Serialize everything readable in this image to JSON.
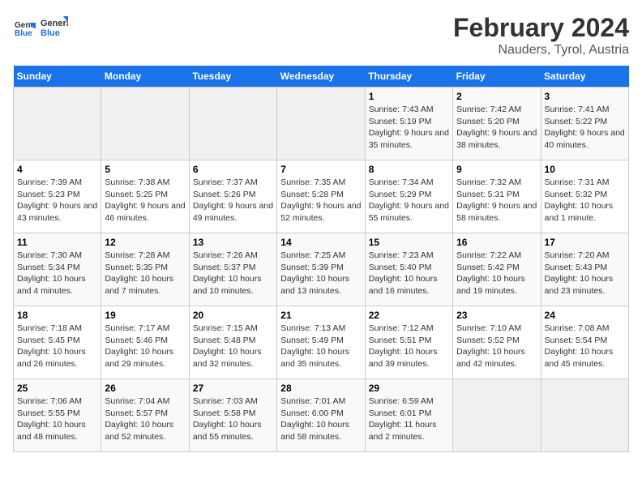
{
  "header": {
    "logo_text_general": "General",
    "logo_text_blue": "Blue",
    "title": "February 2024",
    "subtitle": "Nauders, Tyrol, Austria"
  },
  "calendar": {
    "days_of_week": [
      "Sunday",
      "Monday",
      "Tuesday",
      "Wednesday",
      "Thursday",
      "Friday",
      "Saturday"
    ],
    "weeks": [
      [
        {
          "day": "",
          "info": ""
        },
        {
          "day": "",
          "info": ""
        },
        {
          "day": "",
          "info": ""
        },
        {
          "day": "",
          "info": ""
        },
        {
          "day": "1",
          "info": "Sunrise: 7:43 AM\nSunset: 5:19 PM\nDaylight: 9 hours and 35 minutes."
        },
        {
          "day": "2",
          "info": "Sunrise: 7:42 AM\nSunset: 5:20 PM\nDaylight: 9 hours and 38 minutes."
        },
        {
          "day": "3",
          "info": "Sunrise: 7:41 AM\nSunset: 5:22 PM\nDaylight: 9 hours and 40 minutes."
        }
      ],
      [
        {
          "day": "4",
          "info": "Sunrise: 7:39 AM\nSunset: 5:23 PM\nDaylight: 9 hours and 43 minutes."
        },
        {
          "day": "5",
          "info": "Sunrise: 7:38 AM\nSunset: 5:25 PM\nDaylight: 9 hours and 46 minutes."
        },
        {
          "day": "6",
          "info": "Sunrise: 7:37 AM\nSunset: 5:26 PM\nDaylight: 9 hours and 49 minutes."
        },
        {
          "day": "7",
          "info": "Sunrise: 7:35 AM\nSunset: 5:28 PM\nDaylight: 9 hours and 52 minutes."
        },
        {
          "day": "8",
          "info": "Sunrise: 7:34 AM\nSunset: 5:29 PM\nDaylight: 9 hours and 55 minutes."
        },
        {
          "day": "9",
          "info": "Sunrise: 7:32 AM\nSunset: 5:31 PM\nDaylight: 9 hours and 58 minutes."
        },
        {
          "day": "10",
          "info": "Sunrise: 7:31 AM\nSunset: 5:32 PM\nDaylight: 10 hours and 1 minute."
        }
      ],
      [
        {
          "day": "11",
          "info": "Sunrise: 7:30 AM\nSunset: 5:34 PM\nDaylight: 10 hours and 4 minutes."
        },
        {
          "day": "12",
          "info": "Sunrise: 7:28 AM\nSunset: 5:35 PM\nDaylight: 10 hours and 7 minutes."
        },
        {
          "day": "13",
          "info": "Sunrise: 7:26 AM\nSunset: 5:37 PM\nDaylight: 10 hours and 10 minutes."
        },
        {
          "day": "14",
          "info": "Sunrise: 7:25 AM\nSunset: 5:39 PM\nDaylight: 10 hours and 13 minutes."
        },
        {
          "day": "15",
          "info": "Sunrise: 7:23 AM\nSunset: 5:40 PM\nDaylight: 10 hours and 16 minutes."
        },
        {
          "day": "16",
          "info": "Sunrise: 7:22 AM\nSunset: 5:42 PM\nDaylight: 10 hours and 19 minutes."
        },
        {
          "day": "17",
          "info": "Sunrise: 7:20 AM\nSunset: 5:43 PM\nDaylight: 10 hours and 23 minutes."
        }
      ],
      [
        {
          "day": "18",
          "info": "Sunrise: 7:18 AM\nSunset: 5:45 PM\nDaylight: 10 hours and 26 minutes."
        },
        {
          "day": "19",
          "info": "Sunrise: 7:17 AM\nSunset: 5:46 PM\nDaylight: 10 hours and 29 minutes."
        },
        {
          "day": "20",
          "info": "Sunrise: 7:15 AM\nSunset: 5:48 PM\nDaylight: 10 hours and 32 minutes."
        },
        {
          "day": "21",
          "info": "Sunrise: 7:13 AM\nSunset: 5:49 PM\nDaylight: 10 hours and 35 minutes."
        },
        {
          "day": "22",
          "info": "Sunrise: 7:12 AM\nSunset: 5:51 PM\nDaylight: 10 hours and 39 minutes."
        },
        {
          "day": "23",
          "info": "Sunrise: 7:10 AM\nSunset: 5:52 PM\nDaylight: 10 hours and 42 minutes."
        },
        {
          "day": "24",
          "info": "Sunrise: 7:08 AM\nSunset: 5:54 PM\nDaylight: 10 hours and 45 minutes."
        }
      ],
      [
        {
          "day": "25",
          "info": "Sunrise: 7:06 AM\nSunset: 5:55 PM\nDaylight: 10 hours and 48 minutes."
        },
        {
          "day": "26",
          "info": "Sunrise: 7:04 AM\nSunset: 5:57 PM\nDaylight: 10 hours and 52 minutes."
        },
        {
          "day": "27",
          "info": "Sunrise: 7:03 AM\nSunset: 5:58 PM\nDaylight: 10 hours and 55 minutes."
        },
        {
          "day": "28",
          "info": "Sunrise: 7:01 AM\nSunset: 6:00 PM\nDaylight: 10 hours and 58 minutes."
        },
        {
          "day": "29",
          "info": "Sunrise: 6:59 AM\nSunset: 6:01 PM\nDaylight: 11 hours and 2 minutes."
        },
        {
          "day": "",
          "info": ""
        },
        {
          "day": "",
          "info": ""
        }
      ]
    ]
  }
}
